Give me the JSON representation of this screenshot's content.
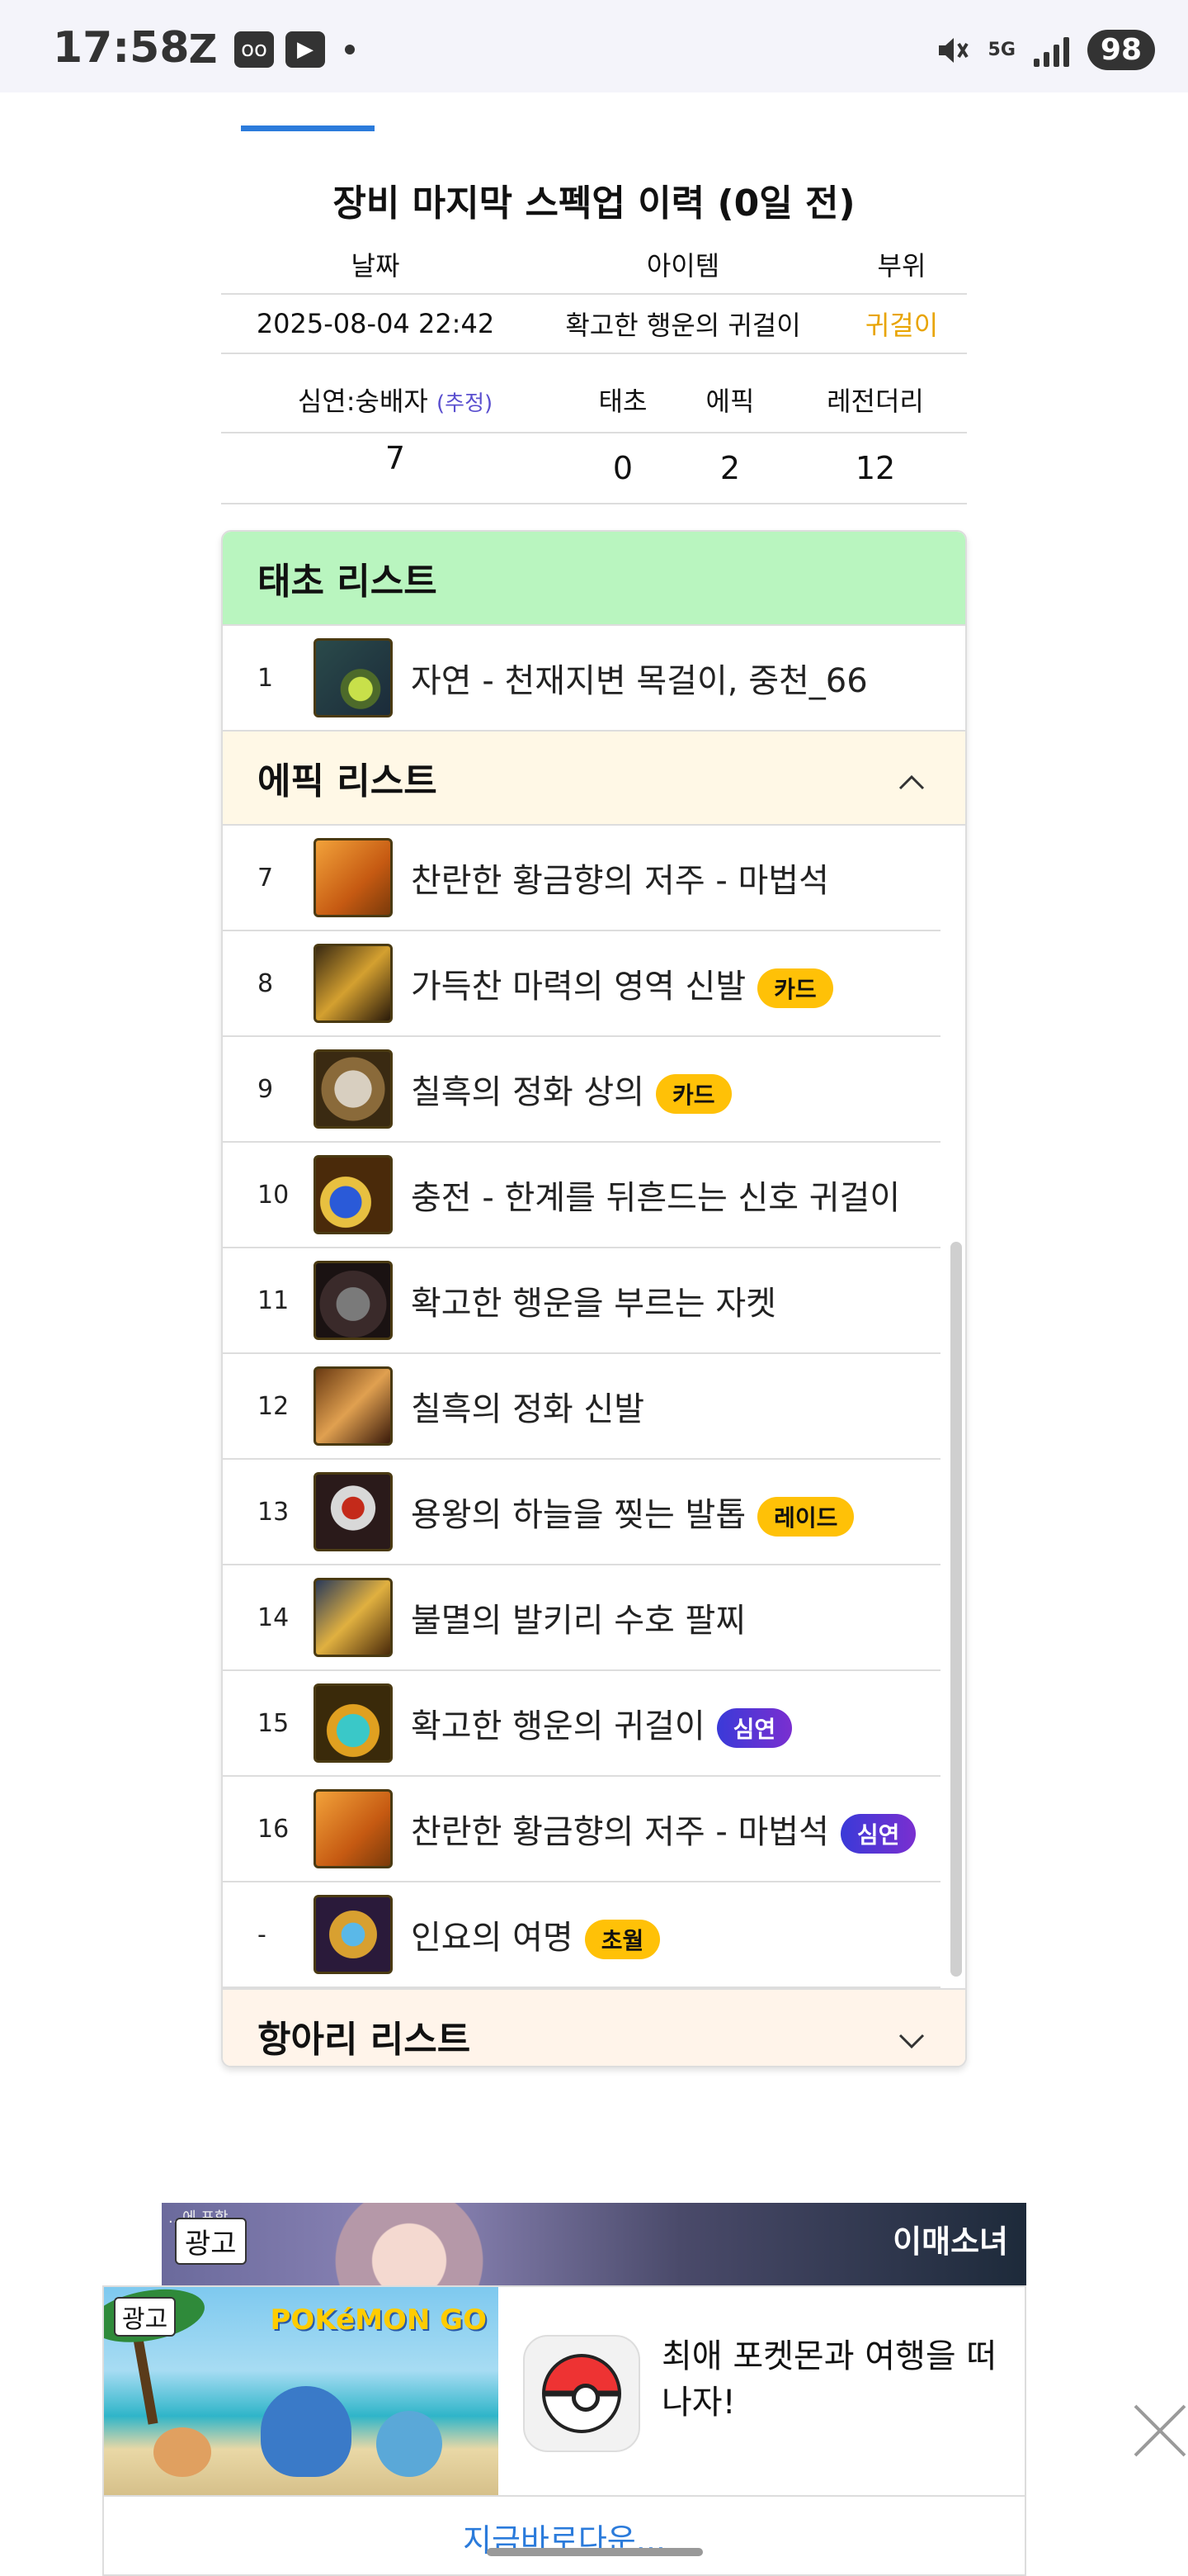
{
  "status_bar": {
    "time": "17:58",
    "left_icons": [
      "z-icon",
      "voicemail-icon",
      "youtube-icon"
    ],
    "network": "5G",
    "battery": "98"
  },
  "history": {
    "title": "장비 마지막 스펙업 이력 (0일 전)",
    "columns": [
      "날짜",
      "아이템",
      "부위"
    ],
    "row": {
      "date": "2025-08-04 22:42",
      "item": "확고한 행운의 귀걸이",
      "slot": "귀걸이"
    },
    "counts_columns": {
      "label": "심연:숭배자",
      "est": "(추정)",
      "c1": "태초",
      "c2": "에픽",
      "c3": "레전더리"
    },
    "counts": {
      "v0": "7",
      "v1": "0",
      "v2": "2",
      "v3": "12"
    }
  },
  "lists": {
    "primal": {
      "title": "태초 리스트",
      "items": [
        {
          "num": "1",
          "name": "자연 - 천재지변 목걸이, 중천_66"
        }
      ]
    },
    "epic": {
      "title": "에픽 리스트",
      "items": [
        {
          "num": "7",
          "name": "찬란한 황금향의 저주 - 마법석",
          "badge": ""
        },
        {
          "num": "8",
          "name": "가득찬 마력의 영역 신발",
          "badge": "카드"
        },
        {
          "num": "9",
          "name": "칠흑의 정화 상의",
          "badge": "카드"
        },
        {
          "num": "10",
          "name": "충전 - 한계를 뒤흔드는 신호 귀걸이",
          "badge": ""
        },
        {
          "num": "11",
          "name": "확고한 행운을 부르는 자켓",
          "badge": ""
        },
        {
          "num": "12",
          "name": "칠흑의 정화 신발",
          "badge": ""
        },
        {
          "num": "13",
          "name": "용왕의 하늘을 찢는 발톱",
          "badge": "레이드"
        },
        {
          "num": "14",
          "name": "불멸의 발키리 수호 팔찌",
          "badge": ""
        },
        {
          "num": "15",
          "name": "확고한 행운의 귀걸이",
          "badge": "심연"
        },
        {
          "num": "16",
          "name": "찬란한 황금향의 저주 - 마법석",
          "badge": "심연"
        },
        {
          "num": "-",
          "name": "인요의 여명",
          "badge": "초월"
        }
      ]
    },
    "jar": {
      "title": "항아리 리스트"
    }
  },
  "ads": {
    "top_label": "광고",
    "top_small": "...에 포함",
    "top_brand": "이매소녀",
    "main_label": "광고",
    "main_logo": "POKéMON GO",
    "main_text": "최애 포켓몬과 여행을 떠나자!",
    "cta": "지금바로다운..."
  },
  "colors": {
    "primal_header": "#b9f5bf",
    "epic_header": "#fff8e6",
    "accent": "#2b7bdb",
    "badge_yellow": "#ffc107",
    "slot_gold": "#e8a400"
  }
}
